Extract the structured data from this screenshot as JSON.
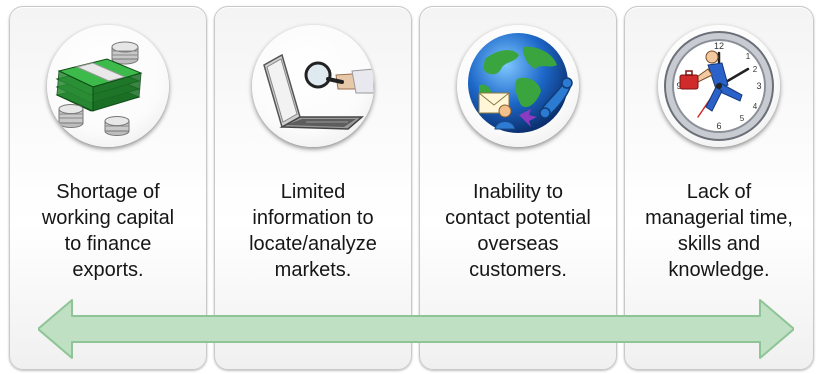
{
  "cards": [
    {
      "caption": "Shortage of\nworking capital\nto finance\nexports.",
      "icon": "money-stack-icon"
    },
    {
      "caption": "Limited\ninformation to\nlocate/analyze\nmarkets.",
      "icon": "laptop-magnifier-icon"
    },
    {
      "caption": "Inability to\ncontact potential\noverseas\ncustomers.",
      "icon": "globe-contact-icon"
    },
    {
      "caption": "Lack of\nmanagerial time,\nskills and\nknowledge.",
      "icon": "clock-runner-icon"
    }
  ],
  "colors": {
    "arrow_fill": "#bfe0c2",
    "arrow_stroke": "#8fc596",
    "money_green": "#2f9a3a",
    "globe_blue": "#1d68c9"
  }
}
